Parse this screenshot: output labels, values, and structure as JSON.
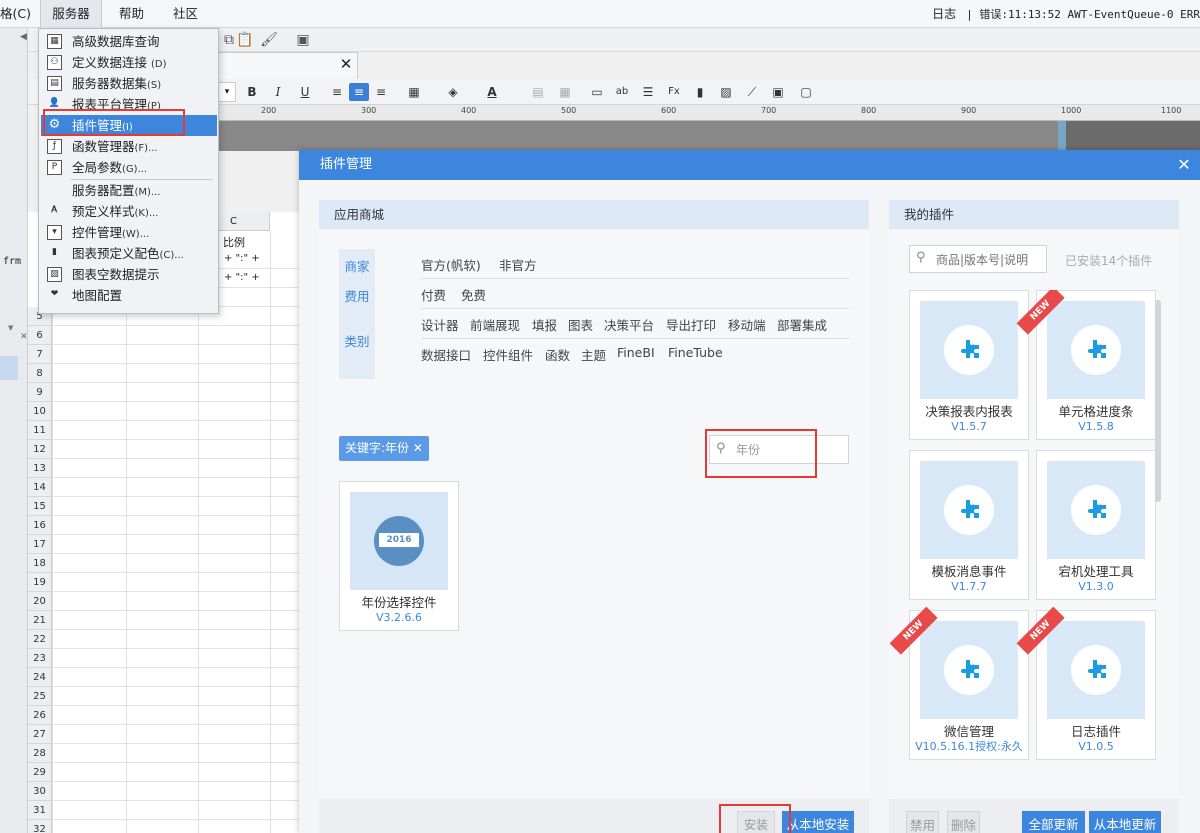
{
  "menubar": {
    "partial_label": "格(C)",
    "items": [
      "服务器",
      "帮助",
      "社区"
    ],
    "status_log": "日志",
    "status_error": "| 错误:11:13:52 AWT-EventQueue-0 ERR"
  },
  "sheet": {
    "col_c": "C",
    "row_label_c": "比例",
    "row2_text": "+ \":\" +",
    "row3_text": "+ \":\" +",
    "row_numbers": [
      "5",
      "6",
      "7",
      "8",
      "9",
      "10",
      "11",
      "12",
      "13",
      "14",
      "15",
      "16",
      "17",
      "18",
      "19",
      "20",
      "21",
      "22",
      "23",
      "24",
      "25",
      "26",
      "27",
      "28",
      "29",
      "30",
      "31",
      "32"
    ],
    "left_text": "frm"
  },
  "dropdown": {
    "items": [
      {
        "label": "高级数据库查询",
        "acc": "",
        "icon": "table-icon"
      },
      {
        "label": "定义数据连接",
        "acc": "(D)",
        "icon": "connection-icon"
      },
      {
        "label": "服务器数据集",
        "acc": "(S)",
        "icon": "dataset-icon"
      },
      {
        "label": "报表平台管理",
        "acc": "(P)",
        "icon": "user-icon"
      },
      {
        "label": "插件管理",
        "acc": "(I)",
        "icon": "plugin-gear-icon"
      },
      {
        "label": "函数管理器",
        "acc": "(F)...",
        "icon": "function-icon"
      },
      {
        "label": "全局参数",
        "acc": "(G)...",
        "icon": "param-icon"
      },
      {
        "label": "服务器配置",
        "acc": "(M)...",
        "icon": "server-config-icon"
      },
      {
        "label": "预定义样式",
        "acc": "(K)...",
        "icon": "style-icon"
      },
      {
        "label": "控件管理",
        "acc": "(W)...",
        "icon": "widget-icon"
      },
      {
        "label": "图表预定义配色",
        "acc": "(C)...",
        "icon": "chart-color-icon"
      },
      {
        "label": "图表空数据提示",
        "acc": "",
        "icon": "chart-empty-icon"
      },
      {
        "label": "地图配置",
        "acc": "",
        "icon": "map-icon"
      }
    ]
  },
  "dialog": {
    "title": "插件管理",
    "store": {
      "heading": "应用商城",
      "filter_labels": [
        "商家",
        "费用",
        "类别"
      ],
      "vendor_options": [
        "官方(帆软)",
        "非官方"
      ],
      "fee_options": [
        "付费",
        "免费"
      ],
      "category_row1": [
        "设计器",
        "前端展现",
        "填报",
        "图表",
        "决策平台",
        "导出打印",
        "移动端",
        "部署集成"
      ],
      "category_row2": [
        "数据接口",
        "控件组件",
        "函数",
        "主题",
        "FineBI",
        "FineTube"
      ],
      "keyword_tag": "关键字:年份",
      "keyword_tag_close": "✕",
      "search_value": "年份",
      "results": [
        {
          "name": "年份选择控件",
          "version": "V3.2.6.6",
          "thumb_text": "2016"
        }
      ],
      "install_button": "安装",
      "local_install_button": "从本地安装"
    },
    "mine": {
      "heading": "我的插件",
      "search_placeholder": "商品|版本号|说明",
      "installed_count": "已安装14个插件",
      "plugins": [
        {
          "name": "决策报表内报表",
          "version": "V1.5.7",
          "new": false
        },
        {
          "name": "单元格进度条",
          "version": "V1.5.8",
          "new": true
        },
        {
          "name": "模板消息事件",
          "version": "V1.7.7",
          "new": false
        },
        {
          "name": "宕机处理工具",
          "version": "V1.3.0",
          "new": false
        },
        {
          "name": "微信管理",
          "version": "V10.5.16.1授权:永久",
          "new": true
        },
        {
          "name": "日志插件",
          "version": "V1.0.5",
          "new": true
        }
      ],
      "new_badge": "NEW",
      "disable_button": "禁用",
      "delete_button": "删除",
      "update_all_button": "全部更新",
      "local_update_button": "从本地更新"
    }
  },
  "colors": {
    "accent": "#3c87dd",
    "highlight_red": "#e53935",
    "panel_head": "#dde9f7",
    "new_ribbon": "#e84a4a"
  }
}
